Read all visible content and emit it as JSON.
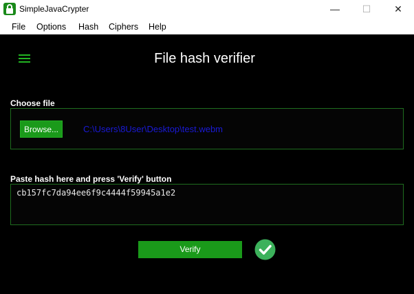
{
  "window": {
    "title": "SimpleJavaCrypter",
    "minimize_symbol": "—",
    "maximize_symbol": "☐",
    "close_symbol": "✕"
  },
  "menu": [
    {
      "label": "File"
    },
    {
      "label": "Options"
    },
    {
      "label": "Hash"
    },
    {
      "label": "Ciphers"
    },
    {
      "label": "Help"
    }
  ],
  "page": {
    "title": "File hash verifier"
  },
  "choose_file": {
    "label": "Choose file",
    "browse_label": "Browse...",
    "path": "C:\\Users\\8User\\Desktop\\test.webm"
  },
  "hash": {
    "label": "Paste hash here and press 'Verify' button",
    "value": "cb157fc7da94ee6f9c4444f59945a1e2"
  },
  "verify": {
    "label": "Verify",
    "status_icon": "check-circle-icon"
  },
  "colors": {
    "accent": "#1a9a1a",
    "background": "#000000",
    "path_text": "#1a1ad6"
  }
}
